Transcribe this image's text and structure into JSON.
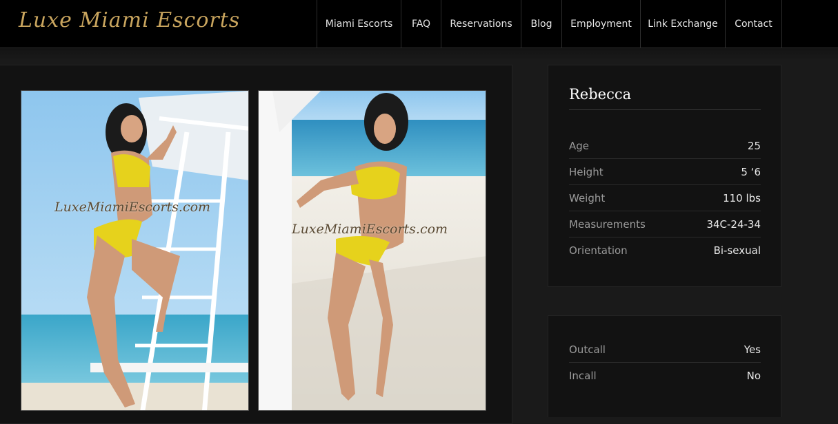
{
  "site": {
    "logo_text": "Luxe Miami Escorts"
  },
  "nav": {
    "items": [
      {
        "label": "Miami Escorts"
      },
      {
        "label": "FAQ"
      },
      {
        "label": "Reservations"
      },
      {
        "label": "Blog"
      },
      {
        "label": "Employment"
      },
      {
        "label": "Link Exchange"
      },
      {
        "label": "Contact"
      }
    ]
  },
  "gallery": {
    "photos": [
      {
        "watermark": "LuxeMiamiEscorts.com"
      },
      {
        "watermark": "LuxeMiamiEscorts.com"
      }
    ]
  },
  "profile": {
    "name": "Rebecca",
    "stats": [
      {
        "label": "Age",
        "value": "25"
      },
      {
        "label": "Height",
        "value": "5 ‘6"
      },
      {
        "label": "Weight",
        "value": "110 lbs"
      },
      {
        "label": "Measurements",
        "value": "34C-24-34"
      },
      {
        "label": "Orientation",
        "value": "Bi-sexual"
      }
    ],
    "services": [
      {
        "label": "Outcall",
        "value": "Yes"
      },
      {
        "label": "Incall",
        "value": "No"
      }
    ]
  },
  "colors": {
    "logo": "#c9a55e",
    "background": "#1a1a1a",
    "header": "#000000",
    "swimsuit": "#e6d21c"
  }
}
